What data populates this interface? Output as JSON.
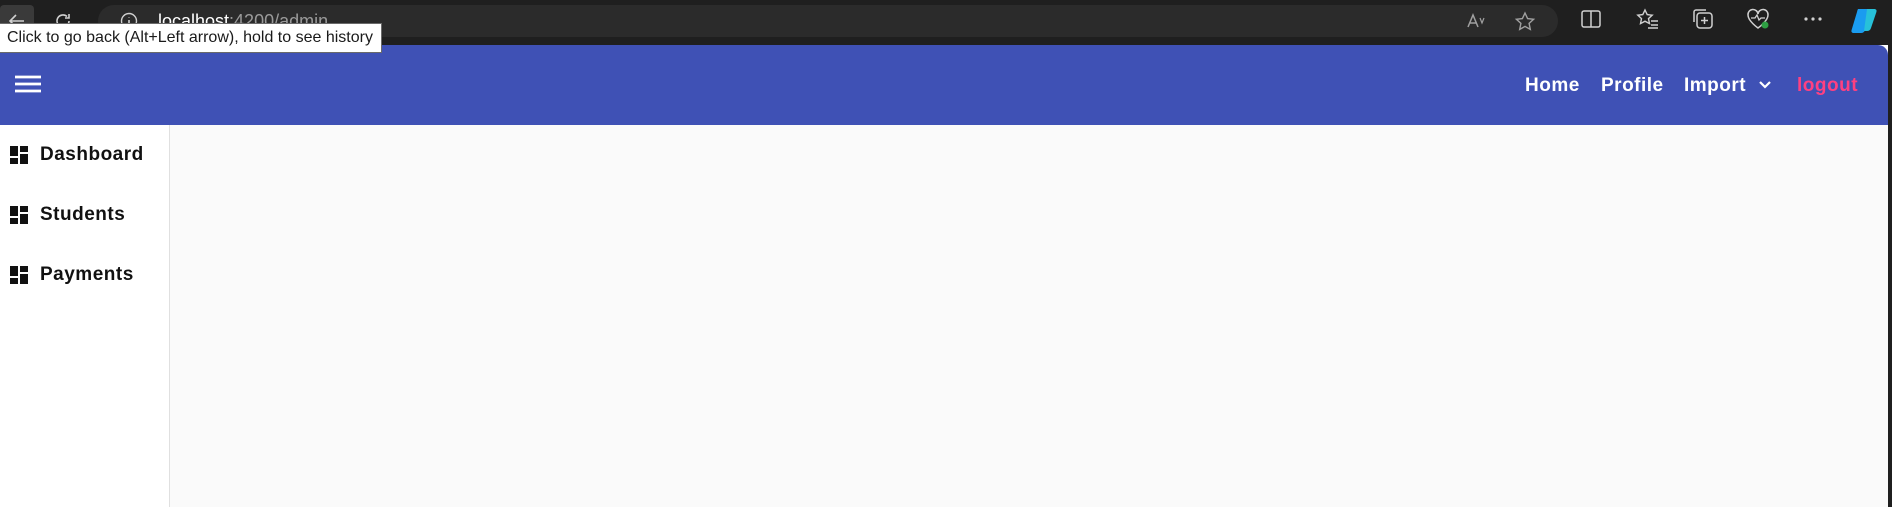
{
  "browser": {
    "url_host": "localhost",
    "url_rest": ":4200/admin",
    "tooltip": "Click to go back (Alt+Left arrow), hold to see history",
    "icons": [
      "back-icon",
      "refresh-icon",
      "info-icon",
      "read-aloud-icon",
      "favorite-star-icon",
      "split-screen-icon",
      "favorites-icon",
      "collections-icon",
      "browser-essentials-icon",
      "more-icon",
      "copilot-icon"
    ]
  },
  "header": {
    "nav": {
      "home": "Home",
      "profile": "Profile",
      "import": "Import",
      "logout": "logout"
    },
    "colors": {
      "primary": "#3f51b5",
      "logout": "#ff4081"
    }
  },
  "sidebar": {
    "items": [
      {
        "label": "Dashboard",
        "icon": "dashboard-icon"
      },
      {
        "label": "Students",
        "icon": "dashboard-icon"
      },
      {
        "label": "Payments",
        "icon": "dashboard-icon"
      }
    ]
  }
}
